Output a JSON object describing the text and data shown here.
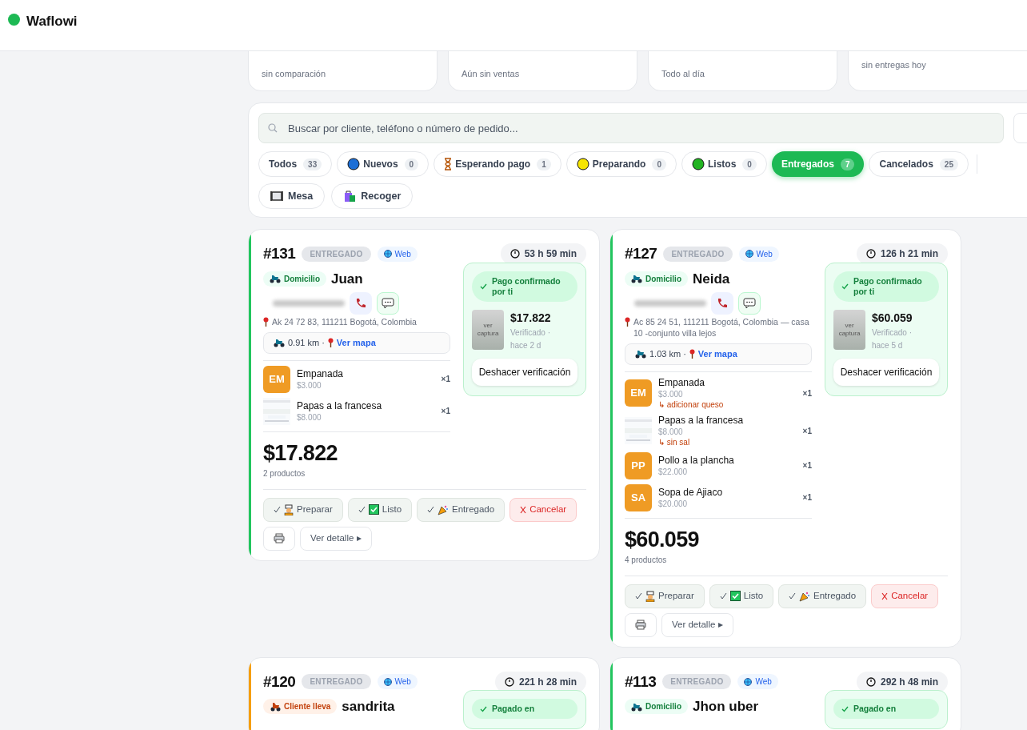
{
  "header": {
    "brand": "Waflowi"
  },
  "stats": [
    {
      "caption": "sin comparación",
      "kind": "value"
    },
    {
      "caption": "Aún sin ventas",
      "kind": "value"
    },
    {
      "caption": "Todo al día",
      "kind": "value"
    },
    {
      "caption": "sin entregas hoy",
      "kind": "plain"
    }
  ],
  "search": {
    "placeholder": "Buscar por cliente, teléfono o número de pedido..."
  },
  "filters": [
    {
      "label": "Todos",
      "count": "33",
      "selected": false
    },
    {
      "label": "Nuevos",
      "count": "0",
      "kind": "new",
      "selected": false
    },
    {
      "label": "Esperando pago",
      "count": "1",
      "kind": "awaiting",
      "selected": false
    },
    {
      "label": "Preparando",
      "count": "0",
      "kind": "preparing",
      "selected": false
    },
    {
      "label": "Listos",
      "count": "0",
      "kind": "ready",
      "selected": false
    },
    {
      "label": "Entregados",
      "count": "7",
      "selected": true
    },
    {
      "label": "Cancelados",
      "count": "25",
      "selected": false
    }
  ],
  "filters_row2": [
    {
      "label": "Mesa",
      "kind": "table",
      "selected": false
    },
    {
      "label": "Recoger",
      "kind": "pickup",
      "selected": false
    }
  ],
  "orders": [
    {
      "number": "#131",
      "status": "ENTREGADO",
      "channel": "Web",
      "timer": "53 h 59 min",
      "color": "#22c55e",
      "delivery": {
        "kind": "moto",
        "label": "Domicilio"
      },
      "customer": "Juan",
      "address": "Ak 24 72 83, 111211 Bogotá, Colombia",
      "distance": "0.91 km ·",
      "map_link": "Ver mapa",
      "payment": {
        "status": "Pago confirmado por ti",
        "thumb": "ver captura",
        "amount": "$17.822",
        "verified": "Verificado · hace 2 d",
        "undo": "Deshacer verificación"
      },
      "items": [
        {
          "kind": "initials",
          "initials": "EM",
          "name": "Empanada",
          "price": "$3.000",
          "qty": "×1"
        },
        {
          "name": "Papas a la francesa",
          "price": "$8.000",
          "qty": "×1"
        }
      ],
      "total": "$17.822",
      "count": "2 productos",
      "actions": [
        {
          "kind": "prep",
          "label": "Preparar"
        },
        {
          "kind": "ready",
          "label": "Listo"
        },
        {
          "kind": "delivered",
          "label": "Entregado"
        },
        {
          "kind": "cancel",
          "label": "Cancelar"
        }
      ],
      "detail": "Ver detalle ▸"
    },
    {
      "number": "#127",
      "status": "ENTREGADO",
      "channel": "Web",
      "timer": "126 h 21 min",
      "color": "#22c55e",
      "delivery": {
        "kind": "moto",
        "label": "Domicilio"
      },
      "customer": "Neida",
      "address": "Ac 85 24 51, 111211 Bogotá, Colombia — casa 10 -conjunto villa lejos",
      "distance": "1.03 km ·",
      "map_link": "Ver mapa",
      "payment": {
        "status": "Pago confirmado por ti",
        "thumb": "ver captura",
        "amount": "$60.059",
        "verified": "Verificado · hace 5 d",
        "undo": "Deshacer verificación"
      },
      "items": [
        {
          "kind": "initials",
          "initials": "EM",
          "name": "Empanada",
          "price": "$3.000",
          "note": "↳ adicionar queso",
          "qty": "×1"
        },
        {
          "name": "Papas a la francesa",
          "price": "$8.000",
          "note": "↳ sin sal",
          "qty": "×1"
        },
        {
          "kind": "initials",
          "initials": "PP",
          "name": "Pollo a la plancha",
          "price": "$22.000",
          "qty": "×1"
        },
        {
          "kind": "initials",
          "initials": "SA",
          "name": "Sopa de Ajiaco",
          "price": "$20.000",
          "qty": "×1"
        }
      ],
      "total": "$60.059",
      "count": "4 productos",
      "actions": [
        {
          "kind": "prep",
          "label": "Preparar"
        },
        {
          "kind": "ready",
          "label": "Listo"
        },
        {
          "kind": "delivered",
          "label": "Entregado"
        },
        {
          "kind": "cancel",
          "label": "Cancelar"
        }
      ],
      "detail": "Ver detalle ▸"
    },
    {
      "number": "#120",
      "status": "ENTREGADO",
      "channel": "Web",
      "timer": "221 h 28 min",
      "color": "#f59e0b",
      "delivery": {
        "kind": "carry",
        "label": "Cliente lleva"
      },
      "customer": "sandrita",
      "payment": {
        "status": "Pagado en"
      }
    },
    {
      "number": "#113",
      "status": "ENTREGADO",
      "channel": "Web",
      "timer": "292 h 48 min",
      "color": "#22c55e",
      "delivery": {
        "kind": "moto",
        "label": "Domicilio"
      },
      "customer": "Jhon uber",
      "payment": {
        "status": "Pagado en"
      }
    }
  ]
}
